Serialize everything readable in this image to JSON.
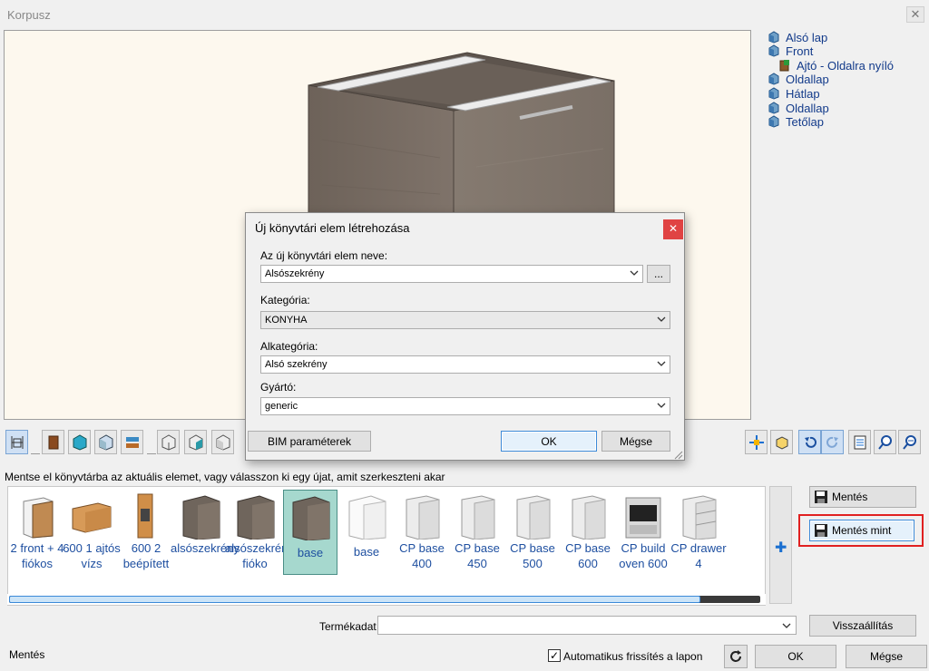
{
  "window": {
    "title": "Korpusz",
    "close_glyph": "✕"
  },
  "tree": {
    "items": [
      {
        "label": "Alsó lap",
        "icon": "cube-part-icon"
      },
      {
        "label": "Front",
        "icon": "cube-part-icon"
      },
      {
        "label": "Ajtó - Oldalra nyíló",
        "icon": "door-part-icon"
      },
      {
        "label": "Oldallap",
        "icon": "cube-part-icon"
      },
      {
        "label": "Hátlap",
        "icon": "cube-part-icon"
      },
      {
        "label": "Oldallap",
        "icon": "cube-part-icon"
      },
      {
        "label": "Tetőlap",
        "icon": "cube-part-icon"
      }
    ]
  },
  "toolbar": {
    "left_icons": [
      "dimensions-icon",
      "door-icon",
      "glass-panel-icon",
      "wireframe-icon",
      "drawer-icon",
      "box-open-icon",
      "box-teal-icon",
      "box-front-icon"
    ],
    "right_icons": [
      "move-icon",
      "box-view-icon",
      "undo-icon",
      "redo-icon",
      "list-icon",
      "zoom-in-icon",
      "zoom-out-icon"
    ]
  },
  "instruction": "Mentse el könyvtárba az aktuális elemet, vagy válasszon ki egy újat, amit szerkeszteni akar",
  "gallery": {
    "items": [
      {
        "label": "2 front + 4 fiókos",
        "thumb": "light-cabinet"
      },
      {
        "label": "600 1 ajtós vízs",
        "thumb": "wood-wall"
      },
      {
        "label": "600 2 beépített",
        "thumb": "wood-tall"
      },
      {
        "label": "alsószekrény",
        "thumb": "grey-cabinet"
      },
      {
        "label": "alsószekrény fióko",
        "thumb": "grey-cabinet"
      },
      {
        "label": "base",
        "thumb": "grey-cabinet",
        "selected": true
      },
      {
        "label": "base",
        "thumb": "white-open"
      },
      {
        "label": "CP base 400",
        "thumb": "white-cabinet"
      },
      {
        "label": "CP base 450",
        "thumb": "white-cabinet"
      },
      {
        "label": "CP base 500",
        "thumb": "white-cabinet"
      },
      {
        "label": "CP base 600",
        "thumb": "white-cabinet"
      },
      {
        "label": "CP build oven 600",
        "thumb": "oven"
      },
      {
        "label": "CP drawer 4",
        "thumb": "white-drawers"
      }
    ],
    "scroll_position": 0.92
  },
  "buttons": {
    "save": "Mentés",
    "save_as": "Mentés mint",
    "restore": "Visszaállítás",
    "ok": "OK",
    "cancel": "Mégse"
  },
  "product_data": {
    "label": "Termékadat",
    "value": ""
  },
  "status": "Mentés",
  "auto_refresh": {
    "label": "Automatikus frissítés a lapon",
    "checked": true,
    "check_glyph": "✓"
  },
  "dialog": {
    "title": "Új könyvtári elem létrehozása",
    "close_glyph": "✕",
    "name_label": "Az új könyvtári elem neve:",
    "name_value": "Alsószekrény",
    "browse_label": "...",
    "category_label": "Kategória:",
    "category_value": "KONYHA",
    "subcategory_label": "Alkategória:",
    "subcategory_value": "Alsó szekrény",
    "manufacturer_label": "Gyártó:",
    "manufacturer_value": "generic",
    "bim_button": "BIM paraméterek",
    "ok": "OK",
    "cancel": "Mégse"
  }
}
